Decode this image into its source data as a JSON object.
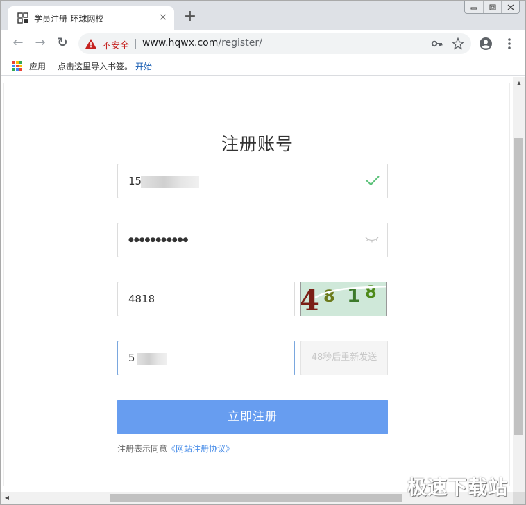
{
  "tab": {
    "title": "学员注册-环球网校",
    "close": "×"
  },
  "new_tab": "+",
  "window_controls": {
    "minimize": "▭",
    "maximize": "▢",
    "close": "✕"
  },
  "toolbar": {
    "back": "←",
    "forward": "→",
    "reload": "↻"
  },
  "omnibox": {
    "security_label": "不安全",
    "url_host": "www.hqwx.com",
    "url_path": "/register/"
  },
  "bookmarks": {
    "apps_label": "应用",
    "import_hint": "点击这里导入书签。",
    "start_link": "开始"
  },
  "form": {
    "title": "注册账号",
    "phone_value": "15",
    "password_value": "●●●●●●●●●●●",
    "captcha_input_value": "4818",
    "captcha_image_text": [
      "4",
      "8",
      "1",
      "8"
    ],
    "sms_code_value": "5",
    "resend_label": "48秒后重新发送",
    "submit_label": "立即注册",
    "agree_text": "注册表示同意",
    "agree_link": "《网站注册协议》"
  },
  "watermark": "极速下载站",
  "colors": {
    "accent": "#679df0",
    "insecure": "#c5221f",
    "link": "#4a8ee8",
    "check": "#5cc27a"
  },
  "icons": {
    "favicon": "hqwx-logo-icon",
    "apps": "apps-grid-icon",
    "warning": "warning-triangle-icon",
    "key": "key-icon",
    "star": "star-icon",
    "account": "account-circle-icon",
    "menu": "more-vert-icon",
    "check": "check-icon",
    "eye": "eye-closed-icon"
  }
}
